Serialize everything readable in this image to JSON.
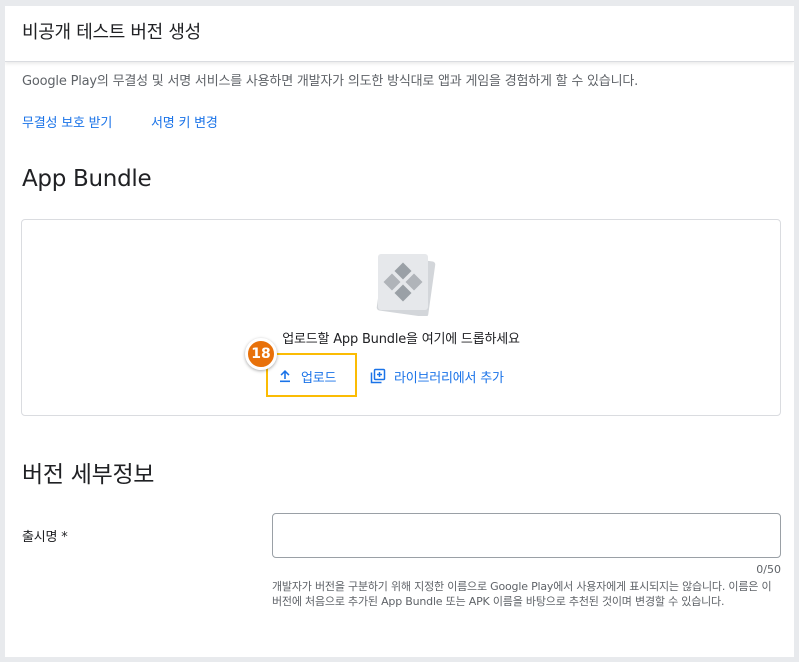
{
  "header": {
    "title": "비공개 테스트 버전 생성"
  },
  "signing": {
    "description": "Google Play의 무결성 및 서명 서비스를 사용하면 개발자가 의도한 방식대로 앱과 게임을 경험하게 할 수 있습니다.",
    "integrity_link": "무결성 보호 받기",
    "change_key_link": "서명 키 변경"
  },
  "app_bundle": {
    "title": "App Bundle",
    "drop_text": "업로드할 App Bundle을 여기에 드롭하세요",
    "upload_label": "업로드",
    "add_from_library_label": "라이브러리에서 추가",
    "bundle_icon": "app-bundle-icon",
    "upload_icon": "upload-icon",
    "library_icon": "library-add-icon",
    "step_badge": "18"
  },
  "release_details": {
    "title": "버전 세부정보",
    "release_name_label": "출시명 *",
    "release_name_value": "",
    "char_counter": "0/50",
    "helper_text": "개발자가 버전을 구분하기 위해 지정한 이름으로 Google Play에서 사용자에게 표시되지는 않습니다. 이름은 이 버전에 처음으로 추가된 App Bundle 또는 APK 이름을 바탕으로 추천된 것이며 변경할 수 있습니다."
  },
  "colors": {
    "link": "#1a73e8",
    "highlight": "#fbbc04",
    "badge": "#e8710a",
    "text_primary": "#202124",
    "text_secondary": "#5f6368"
  }
}
